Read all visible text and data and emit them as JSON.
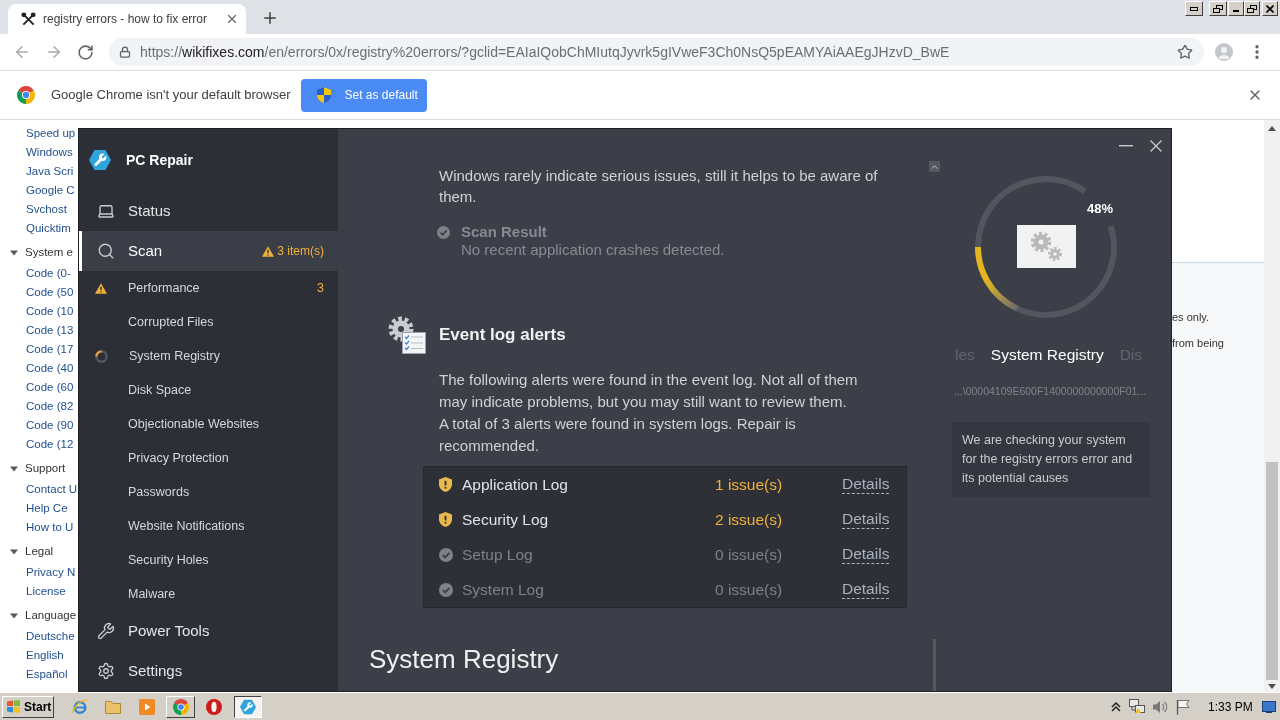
{
  "browser": {
    "tab": {
      "title": "registry errors - how to fix error",
      "selected": true
    },
    "url": {
      "scheme": "https://",
      "host": "wikifixes.com",
      "path": "/en/errors/0x/registry%20errors/?gclid=EAIaIQobChMIutqJyvrk5gIVweF3Ch0NsQ5pEAMYAiAAEgJHzvD_BwE"
    },
    "infobar": {
      "message": "Google Chrome isn't your default browser",
      "button": "Set as default"
    }
  },
  "webpage": {
    "tree": [
      {
        "children": [
          {
            "label": "Speed up"
          },
          {
            "label": "Windows"
          },
          {
            "label": "Java Scri"
          },
          {
            "label": "Google C"
          },
          {
            "label": "Svchost"
          },
          {
            "label": "Quicktim"
          }
        ]
      },
      {
        "label": "System e",
        "expanded": true,
        "children": [
          {
            "label": "Code (0-"
          },
          {
            "label": "Code (50"
          },
          {
            "label": "Code (10"
          },
          {
            "label": "Code (13"
          },
          {
            "label": "Code (17"
          },
          {
            "label": "Code (40"
          },
          {
            "label": "Code (60"
          },
          {
            "label": "Code (82"
          },
          {
            "label": "Code (90"
          },
          {
            "label": "Code (12"
          }
        ]
      },
      {
        "label": "Support",
        "expanded": true,
        "children": [
          {
            "label": "Contact U"
          },
          {
            "label": "Help Ce"
          },
          {
            "label": "How to U"
          }
        ]
      },
      {
        "label": "Legal",
        "expanded": true,
        "children": [
          {
            "label": "Privacy N"
          },
          {
            "label": "License"
          }
        ]
      },
      {
        "label": "Language",
        "expanded": true,
        "children": [
          {
            "label": "Deutsche"
          },
          {
            "label": "English"
          },
          {
            "label": "Español"
          }
        ]
      }
    ],
    "fragments": [
      "es only.",
      "from being"
    ]
  },
  "app": {
    "title": "PC Repair",
    "nav": [
      {
        "label": "Status",
        "selected": false
      },
      {
        "label": "Scan",
        "selected": true,
        "badge": "3 item(s)",
        "children": [
          {
            "label": "Performance",
            "kind": "warning",
            "count": "3"
          },
          {
            "label": "Corrupted Files",
            "kind": "plain"
          },
          {
            "label": "System Registry",
            "kind": "scanning"
          },
          {
            "label": "Disk Space",
            "kind": "plain"
          },
          {
            "label": "Objectionable Websites",
            "kind": "plain"
          },
          {
            "label": "Privacy Protection",
            "kind": "plain"
          },
          {
            "label": "Passwords",
            "kind": "plain"
          },
          {
            "label": "Website Notifications",
            "kind": "plain"
          },
          {
            "label": "Security Holes",
            "kind": "plain"
          },
          {
            "label": "Malware",
            "kind": "plain"
          }
        ]
      },
      {
        "label": "Power Tools",
        "selected": false
      },
      {
        "label": "Settings",
        "selected": false
      }
    ],
    "content": {
      "intro": "Windows rarely indicate serious issues, still it helps to be aware of them.",
      "scan_result": {
        "title": "Scan Result",
        "text": "No recent application crashes detected."
      },
      "section": {
        "title": "Event log alerts",
        "paragraphs": [
          "The following alerts were found in the event log. Not all of them may indicate problems, but you may still want to review them.",
          "A total of 3 alerts were found in system logs. Repair is recommended."
        ],
        "logs": [
          {
            "name": "Application Log",
            "issues": "1 issue(s)",
            "kind": "warning",
            "link": "Details"
          },
          {
            "name": "Security Log",
            "issues": "2 issue(s)",
            "kind": "warning",
            "link": "Details"
          },
          {
            "name": "Setup Log",
            "issues": "0 issue(s)",
            "kind": "ok",
            "link": "Details"
          },
          {
            "name": "System Log",
            "issues": "0 issue(s)",
            "kind": "ok",
            "link": "Details"
          }
        ]
      },
      "next_heading": "System Registry"
    },
    "panel": {
      "percent": "48%",
      "steps": [
        {
          "label": "les",
          "selected": false
        },
        {
          "label": "System Registry",
          "selected": true
        },
        {
          "label": "Dis",
          "selected": false
        }
      ],
      "path": "...\\00004109E600F1400000000000F01...",
      "message": "We are checking your system for the registry errors error and its potential causes"
    }
  },
  "taskbar": {
    "start": "Start",
    "tasks": [
      {
        "selected": false
      },
      {
        "selected": true
      }
    ],
    "clock": "1:33 PM"
  }
}
